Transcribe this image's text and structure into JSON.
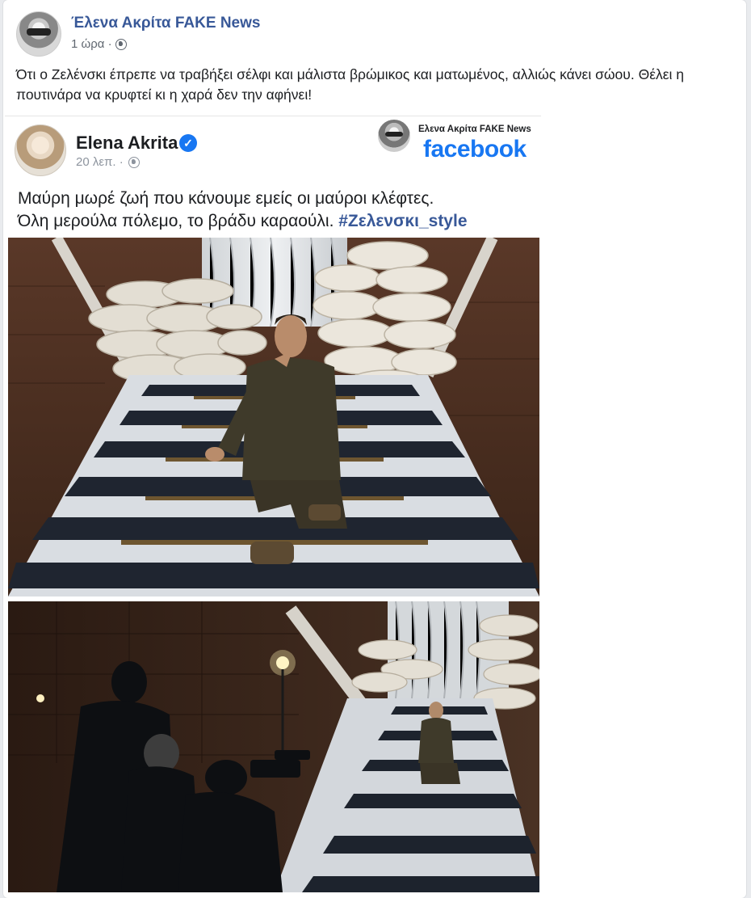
{
  "post": {
    "author": "Έλενα Ακρίτα FAKE News",
    "time": "1 ώρα ·",
    "caption": "Ότι ο Ζελένσκι έπρεπε να τραβήξει σέλφι και μάλιστα βρώμικος και ματωμένος, αλλιώς κάνει σώου. Θέλει η πουτινάρα να κρυφτεί κι η χαρά δεν την αφήνει!"
  },
  "embedded": {
    "author": "Elena Akrita",
    "time": "20 λεπ. ·",
    "text_line1": "Μαύρη μωρέ ζωή που κάνουμε εμείς οι μαύροι κλέφτες.",
    "text_line2": "Όλη μερούλα πόλεμο, το βράδυ καραούλι.",
    "hashtag": "#Ζελενσκι_style",
    "watermark_name": "Ελενα Ακρίτα FAKE News",
    "watermark_brand": "facebook"
  },
  "colors": {
    "link_blue": "#385898",
    "facebook_blue": "#1877f2",
    "meta_gray": "#606770"
  },
  "icons": [
    "globe-icon",
    "verified-badge-icon"
  ]
}
